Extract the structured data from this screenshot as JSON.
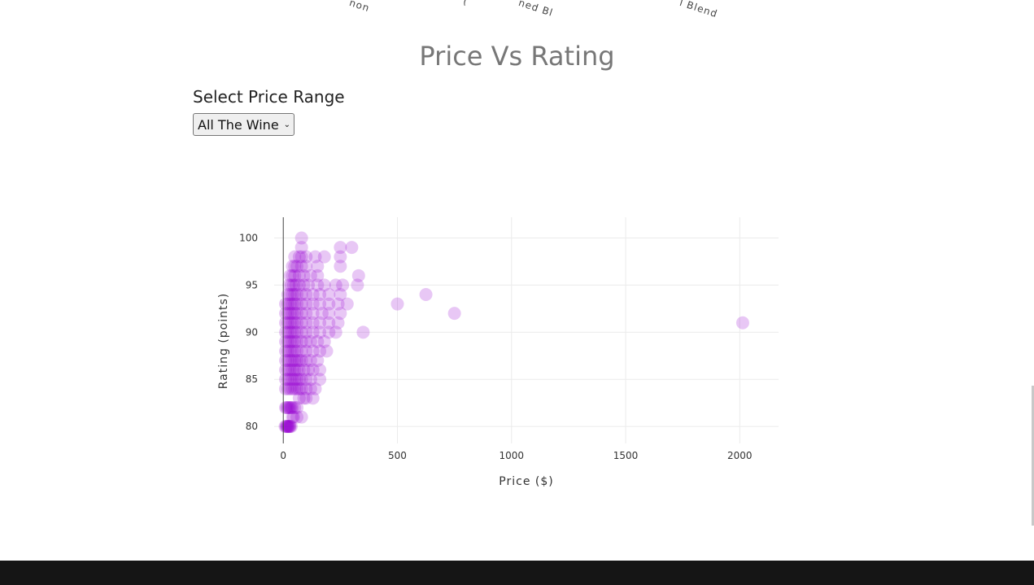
{
  "prev_chart": {
    "label_fragments": [
      "non",
      "(",
      "ned Bl",
      "l Blend"
    ]
  },
  "section": {
    "title": "Price Vs Rating"
  },
  "controls": {
    "range_label": "Select Price Range",
    "select_value": "All The Wine"
  },
  "colors": {
    "point": "#9400d3",
    "footer": "#151515"
  },
  "chart_data": {
    "type": "scatter",
    "title": "",
    "xlabel": "Price ($)",
    "ylabel": "Rating (points)",
    "xlim": [
      -40,
      2170
    ],
    "ylim": [
      78.2,
      102.2
    ],
    "xticks": [
      0,
      500,
      1000,
      1500,
      2000
    ],
    "yticks": [
      80,
      85,
      90,
      95,
      100
    ],
    "grid": true,
    "marker_opacity": 0.22,
    "series": [
      {
        "points": [
          [
            8,
            80
          ],
          [
            12,
            80
          ],
          [
            15,
            80
          ],
          [
            18,
            80
          ],
          [
            20,
            80
          ],
          [
            22,
            80
          ],
          [
            25,
            80
          ],
          [
            28,
            80
          ],
          [
            30,
            80
          ],
          [
            35,
            80
          ],
          [
            40,
            81
          ],
          [
            45,
            81
          ],
          [
            60,
            81
          ],
          [
            80,
            81
          ],
          [
            10,
            82
          ],
          [
            15,
            82
          ],
          [
            20,
            82
          ],
          [
            25,
            82
          ],
          [
            30,
            82
          ],
          [
            35,
            82
          ],
          [
            40,
            82
          ],
          [
            50,
            82
          ],
          [
            60,
            82
          ],
          [
            70,
            83
          ],
          [
            90,
            83
          ],
          [
            100,
            83
          ],
          [
            130,
            83
          ],
          [
            10,
            84
          ],
          [
            20,
            84
          ],
          [
            30,
            84
          ],
          [
            40,
            84
          ],
          [
            50,
            84
          ],
          [
            60,
            84
          ],
          [
            70,
            84
          ],
          [
            80,
            84
          ],
          [
            100,
            84
          ],
          [
            120,
            84
          ],
          [
            140,
            84
          ],
          [
            10,
            85
          ],
          [
            20,
            85
          ],
          [
            30,
            85
          ],
          [
            40,
            85
          ],
          [
            50,
            85
          ],
          [
            60,
            85
          ],
          [
            70,
            85
          ],
          [
            80,
            85
          ],
          [
            100,
            85
          ],
          [
            120,
            85
          ],
          [
            160,
            85
          ],
          [
            10,
            86
          ],
          [
            20,
            86
          ],
          [
            30,
            86
          ],
          [
            40,
            86
          ],
          [
            50,
            86
          ],
          [
            60,
            86
          ],
          [
            70,
            86
          ],
          [
            90,
            86
          ],
          [
            110,
            86
          ],
          [
            130,
            86
          ],
          [
            160,
            86
          ],
          [
            10,
            87
          ],
          [
            20,
            87
          ],
          [
            30,
            87
          ],
          [
            40,
            87
          ],
          [
            50,
            87
          ],
          [
            60,
            87
          ],
          [
            70,
            87
          ],
          [
            80,
            87
          ],
          [
            100,
            87
          ],
          [
            120,
            87
          ],
          [
            150,
            87
          ],
          [
            10,
            88
          ],
          [
            20,
            88
          ],
          [
            30,
            88
          ],
          [
            40,
            88
          ],
          [
            50,
            88
          ],
          [
            60,
            88
          ],
          [
            80,
            88
          ],
          [
            100,
            88
          ],
          [
            130,
            88
          ],
          [
            160,
            88
          ],
          [
            190,
            88
          ],
          [
            10,
            89
          ],
          [
            20,
            89
          ],
          [
            30,
            89
          ],
          [
            40,
            89
          ],
          [
            50,
            89
          ],
          [
            60,
            89
          ],
          [
            80,
            89
          ],
          [
            100,
            89
          ],
          [
            120,
            89
          ],
          [
            150,
            89
          ],
          [
            180,
            89
          ],
          [
            10,
            90
          ],
          [
            20,
            90
          ],
          [
            30,
            90
          ],
          [
            40,
            90
          ],
          [
            50,
            90
          ],
          [
            60,
            90
          ],
          [
            80,
            90
          ],
          [
            100,
            90
          ],
          [
            130,
            90
          ],
          [
            160,
            90
          ],
          [
            200,
            90
          ],
          [
            230,
            90
          ],
          [
            350,
            90
          ],
          [
            10,
            91
          ],
          [
            20,
            91
          ],
          [
            30,
            91
          ],
          [
            40,
            91
          ],
          [
            50,
            91
          ],
          [
            60,
            91
          ],
          [
            80,
            91
          ],
          [
            100,
            91
          ],
          [
            130,
            91
          ],
          [
            160,
            91
          ],
          [
            200,
            91
          ],
          [
            240,
            91
          ],
          [
            2013,
            91
          ],
          [
            10,
            92
          ],
          [
            20,
            92
          ],
          [
            30,
            92
          ],
          [
            40,
            92
          ],
          [
            50,
            92
          ],
          [
            60,
            92
          ],
          [
            80,
            92
          ],
          [
            100,
            92
          ],
          [
            130,
            92
          ],
          [
            170,
            92
          ],
          [
            200,
            92
          ],
          [
            250,
            92
          ],
          [
            750,
            92
          ],
          [
            10,
            93
          ],
          [
            20,
            93
          ],
          [
            30,
            93
          ],
          [
            40,
            93
          ],
          [
            50,
            93
          ],
          [
            60,
            93
          ],
          [
            80,
            93
          ],
          [
            100,
            93
          ],
          [
            130,
            93
          ],
          [
            160,
            93
          ],
          [
            200,
            93
          ],
          [
            240,
            93
          ],
          [
            280,
            93
          ],
          [
            500,
            93
          ],
          [
            20,
            94
          ],
          [
            30,
            94
          ],
          [
            40,
            94
          ],
          [
            50,
            94
          ],
          [
            60,
            94
          ],
          [
            80,
            94
          ],
          [
            100,
            94
          ],
          [
            130,
            94
          ],
          [
            160,
            94
          ],
          [
            200,
            94
          ],
          [
            250,
            94
          ],
          [
            625,
            94
          ],
          [
            25,
            95
          ],
          [
            35,
            95
          ],
          [
            45,
            95
          ],
          [
            55,
            95
          ],
          [
            70,
            95
          ],
          [
            90,
            95
          ],
          [
            110,
            95
          ],
          [
            150,
            95
          ],
          [
            180,
            95
          ],
          [
            230,
            95
          ],
          [
            260,
            95
          ],
          [
            325,
            95
          ],
          [
            30,
            96
          ],
          [
            40,
            96
          ],
          [
            50,
            96
          ],
          [
            70,
            96
          ],
          [
            90,
            96
          ],
          [
            120,
            96
          ],
          [
            150,
            96
          ],
          [
            330,
            96
          ],
          [
            40,
            97
          ],
          [
            50,
            97
          ],
          [
            60,
            97
          ],
          [
            80,
            97
          ],
          [
            100,
            97
          ],
          [
            150,
            97
          ],
          [
            250,
            97
          ],
          [
            50,
            98
          ],
          [
            70,
            98
          ],
          [
            80,
            98
          ],
          [
            100,
            98
          ],
          [
            140,
            98
          ],
          [
            180,
            98
          ],
          [
            250,
            98
          ],
          [
            80,
            99
          ],
          [
            250,
            99
          ],
          [
            300,
            99
          ],
          [
            80,
            100
          ]
        ]
      }
    ]
  },
  "footer": {}
}
